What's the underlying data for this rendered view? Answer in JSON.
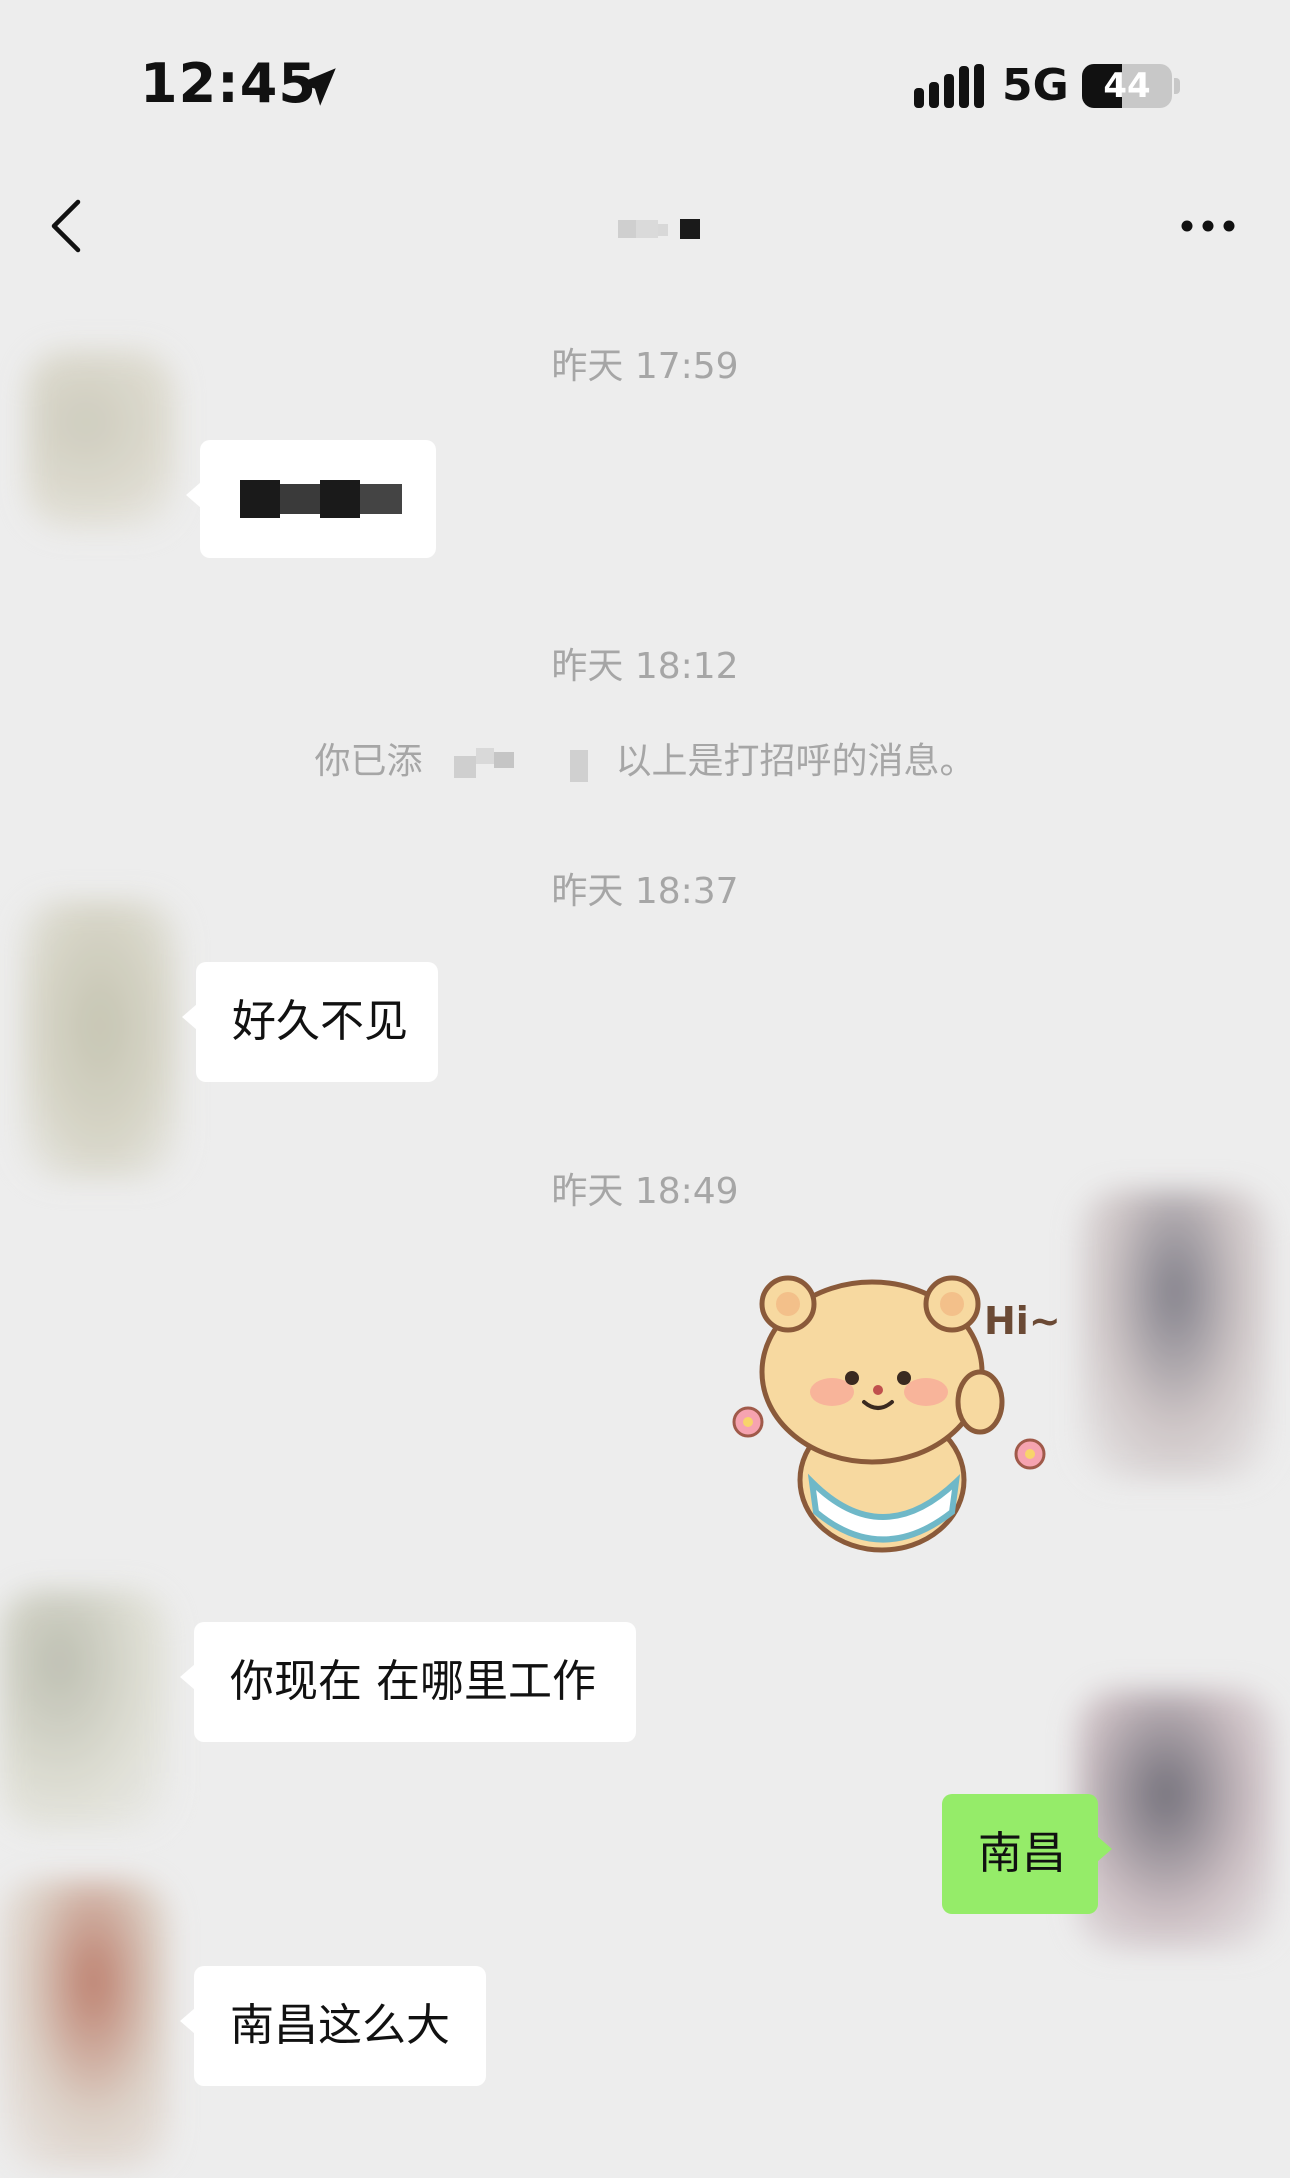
{
  "status_bar": {
    "time": "12:45",
    "network": "5G",
    "battery": "44",
    "battery_level": 0.44
  },
  "nav": {
    "back_icon": "chevron-left-icon",
    "more_icon": "more-horizontal-icon"
  },
  "timestamps": [
    "昨天 17:59",
    "昨天 18:12",
    "昨天 18:37",
    "昨天 18:49"
  ],
  "system_note": {
    "prefix": "你已添",
    "suffix": "以上是打招呼的消息。"
  },
  "messages": [
    {
      "side": "left",
      "text": ""
    },
    {
      "side": "left",
      "text": "好久不见"
    },
    {
      "side": "right",
      "sticker": "bear-hi-sticker",
      "sticker_text": "Hi~"
    },
    {
      "side": "left",
      "text": "你现在 在哪里工作"
    },
    {
      "side": "right",
      "text": "南昌"
    },
    {
      "side": "left",
      "text": "南昌这么大"
    }
  ],
  "colors": {
    "background": "#ededed",
    "own_bubble": "#95ec69",
    "other_bubble": "#ffffff",
    "timestamp": "#a6a6a6"
  }
}
